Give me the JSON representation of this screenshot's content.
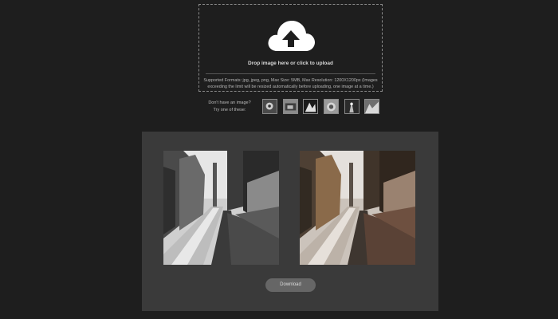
{
  "upload": {
    "prompt": "Drop image here or click to upload",
    "formats": "Supported Formats: jpg, jpeg, png, Max Size: 5MB, Max Resolution: 1200X1200px (Images exceeding the limit will be resized automatically before uploading, one image at a time.)",
    "icon": "cloud-upload-icon"
  },
  "samples": {
    "label_line1": "Don't have an image?",
    "label_line2": "Try one of these:",
    "count": 6
  },
  "result": {
    "download_label": "Download"
  }
}
